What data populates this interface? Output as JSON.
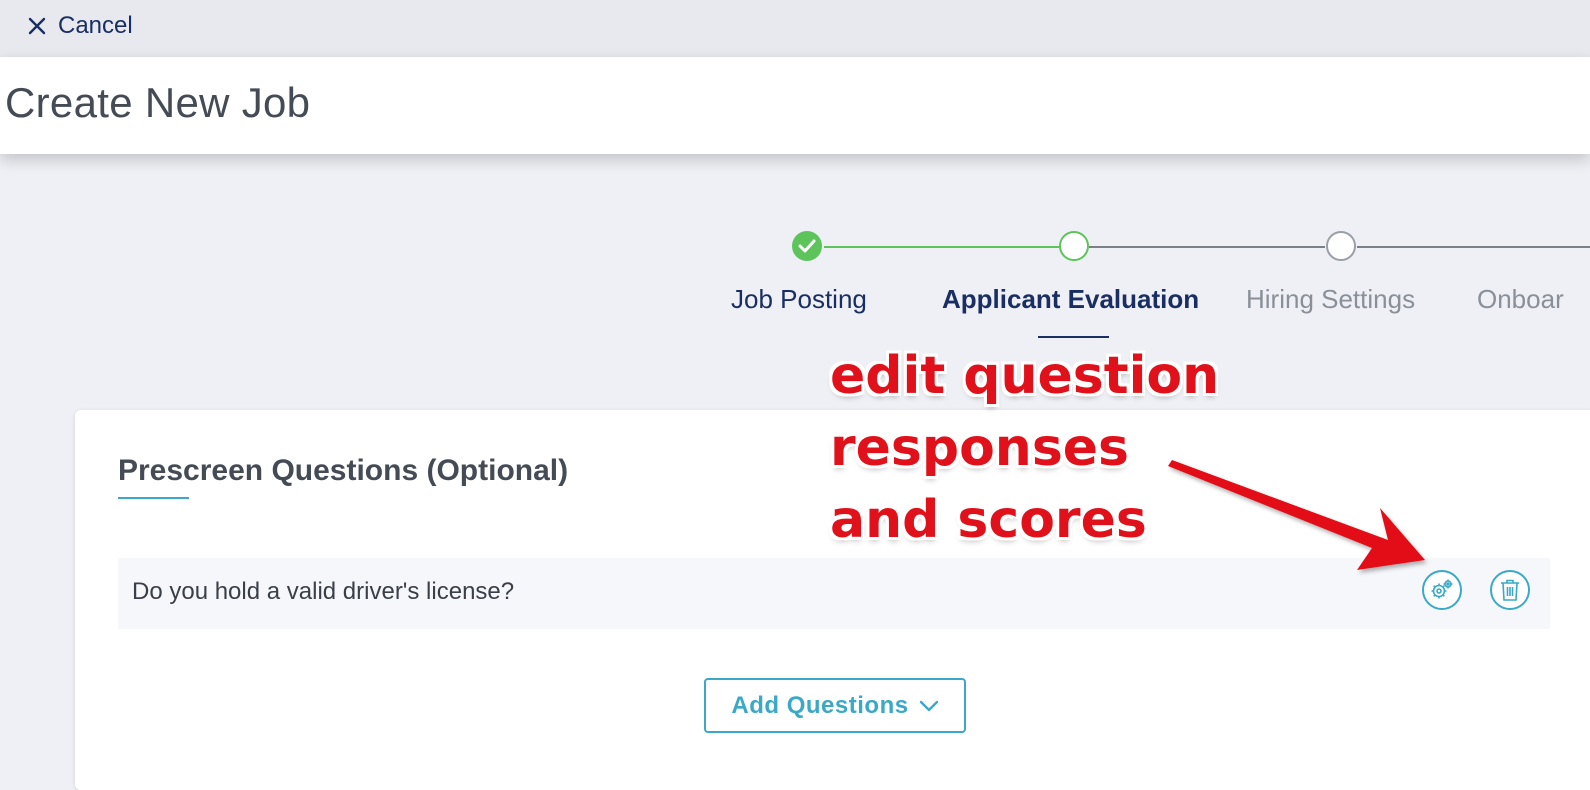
{
  "topbar": {
    "cancel_label": "Cancel",
    "cancel_icon": "close-icon"
  },
  "header": {
    "title": "Create New Job"
  },
  "stepper": {
    "steps": [
      {
        "label": "Job Posting",
        "state": "completed",
        "icon": "check-icon"
      },
      {
        "label": "Applicant Evaluation",
        "state": "active"
      },
      {
        "label": "Hiring Settings",
        "state": "upcoming"
      },
      {
        "label": "Onboar",
        "state": "upcoming"
      }
    ],
    "colors": {
      "completed": "#5cc45a",
      "active_text": "#1a2e63",
      "upcoming": "#8a8f98"
    }
  },
  "card": {
    "title": "Prescreen Questions (Optional)",
    "questions": [
      {
        "text": "Do you hold a valid driver's license?"
      }
    ],
    "settings_icon": "gear-icon",
    "delete_icon": "trash-icon",
    "add_button_label": "Add Questions",
    "add_button_icon": "chevron-down-icon"
  },
  "annotation": {
    "text": "edit question\nresponses\nand scores",
    "color": "#e0111a"
  },
  "colors": {
    "accent": "#3aa8c6",
    "navy": "#1a2e63"
  }
}
